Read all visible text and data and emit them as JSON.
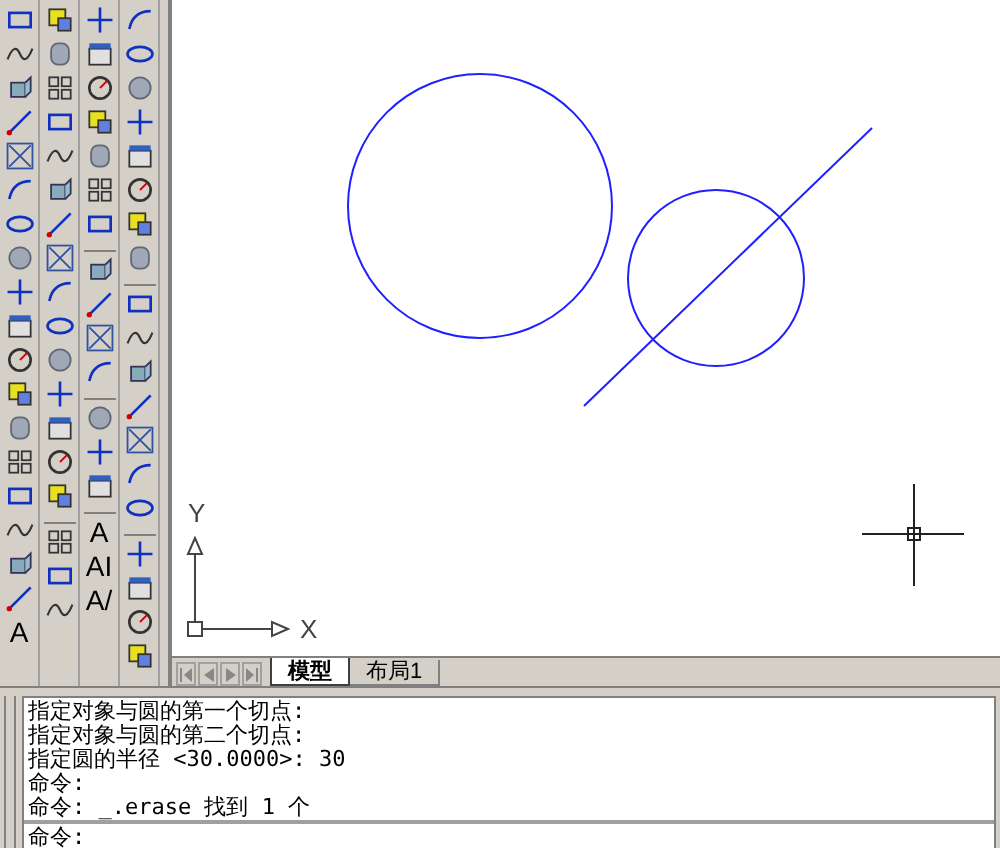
{
  "toolbars": [
    {
      "items": [
        {
          "kind": "icon"
        },
        {
          "kind": "icon"
        },
        {
          "kind": "icon"
        },
        {
          "kind": "icon"
        },
        {
          "kind": "icon"
        },
        {
          "kind": "icon"
        },
        {
          "kind": "icon"
        },
        {
          "kind": "icon"
        },
        {
          "kind": "icon"
        },
        {
          "kind": "icon"
        },
        {
          "kind": "icon"
        },
        {
          "kind": "icon"
        },
        {
          "kind": "icon"
        },
        {
          "kind": "icon"
        },
        {
          "kind": "icon"
        },
        {
          "kind": "icon"
        },
        {
          "kind": "icon"
        },
        {
          "kind": "icon"
        },
        {
          "kind": "text",
          "label": "A"
        }
      ]
    },
    {
      "items": [
        {
          "kind": "icon"
        },
        {
          "kind": "icon"
        },
        {
          "kind": "icon"
        },
        {
          "kind": "icon"
        },
        {
          "kind": "icon"
        },
        {
          "kind": "icon"
        },
        {
          "kind": "icon"
        },
        {
          "kind": "icon"
        },
        {
          "kind": "icon"
        },
        {
          "kind": "icon"
        },
        {
          "kind": "icon"
        },
        {
          "kind": "icon"
        },
        {
          "kind": "icon"
        },
        {
          "kind": "icon"
        },
        {
          "kind": "icon"
        },
        {
          "kind": "separator"
        },
        {
          "kind": "icon"
        },
        {
          "kind": "icon"
        },
        {
          "kind": "icon"
        }
      ]
    },
    {
      "items": [
        {
          "kind": "icon"
        },
        {
          "kind": "icon"
        },
        {
          "kind": "icon"
        },
        {
          "kind": "icon"
        },
        {
          "kind": "icon"
        },
        {
          "kind": "icon"
        },
        {
          "kind": "icon"
        },
        {
          "kind": "separator"
        },
        {
          "kind": "icon"
        },
        {
          "kind": "icon"
        },
        {
          "kind": "icon"
        },
        {
          "kind": "icon"
        },
        {
          "kind": "separator"
        },
        {
          "kind": "icon"
        },
        {
          "kind": "icon"
        },
        {
          "kind": "icon"
        },
        {
          "kind": "separator"
        },
        {
          "kind": "text",
          "label": "A"
        },
        {
          "kind": "text",
          "label": "AI"
        },
        {
          "kind": "text",
          "label": "A/"
        }
      ]
    },
    {
      "items": [
        {
          "kind": "icon"
        },
        {
          "kind": "icon"
        },
        {
          "kind": "icon"
        },
        {
          "kind": "icon"
        },
        {
          "kind": "icon"
        },
        {
          "kind": "icon"
        },
        {
          "kind": "icon"
        },
        {
          "kind": "icon"
        },
        {
          "kind": "separator"
        },
        {
          "kind": "icon"
        },
        {
          "kind": "icon"
        },
        {
          "kind": "icon"
        },
        {
          "kind": "icon"
        },
        {
          "kind": "icon"
        },
        {
          "kind": "icon"
        },
        {
          "kind": "icon"
        },
        {
          "kind": "separator"
        },
        {
          "kind": "icon"
        },
        {
          "kind": "icon"
        },
        {
          "kind": "icon"
        },
        {
          "kind": "icon"
        }
      ]
    }
  ],
  "ucs": {
    "x_label": "X",
    "y_label": "Y"
  },
  "layout_tabs": [
    {
      "label": "模型",
      "selected": true
    },
    {
      "label": "布局1",
      "selected": false
    }
  ],
  "command_history": [
    "指定对象与圆的第一个切点:",
    "指定对象与圆的第二个切点:",
    "指定圆的半径 <30.0000>: 30",
    "命令:",
    "命令: _.erase 找到 1 个"
  ],
  "command_prompt": "命令:"
}
